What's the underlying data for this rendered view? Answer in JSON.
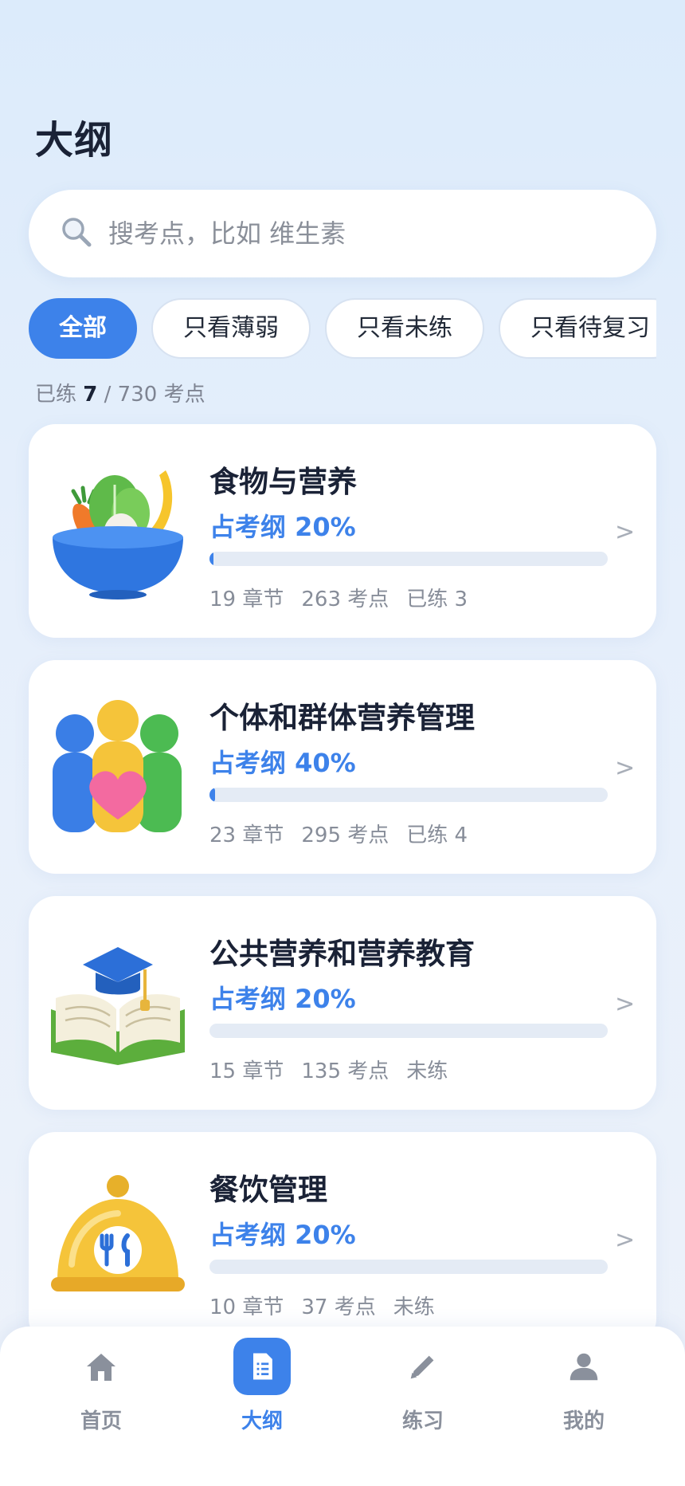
{
  "page": {
    "title": "大纲"
  },
  "search": {
    "placeholder": "搜考点，比如 维生素",
    "icon": "search-icon"
  },
  "filters": [
    {
      "label": "全部",
      "active": true
    },
    {
      "label": "只看薄弱",
      "active": false
    },
    {
      "label": "只看未练",
      "active": false
    },
    {
      "label": "只看待复习",
      "active": false
    }
  ],
  "stats": {
    "prefix": "已练",
    "done": "7",
    "separator": "/",
    "total": "730",
    "suffix": "考点"
  },
  "modules": [
    {
      "title": "食物与营养",
      "weight": "占考纲 20%",
      "progress": 0.011,
      "chapters": "19 章节",
      "points": "263 考点",
      "status": "已练 3",
      "icon": "salad-bowl-icon"
    },
    {
      "title": "个体和群体营养管理",
      "weight": "占考纲 40%",
      "progress": 0.014,
      "chapters": "23 章节",
      "points": "295 考点",
      "status": "已练 4",
      "icon": "family-heart-icon"
    },
    {
      "title": "公共营养和营养教育",
      "weight": "占考纲 20%",
      "progress": 0,
      "chapters": "15 章节",
      "points": "135 考点",
      "status": "未练",
      "icon": "book-graduation-cap-icon"
    },
    {
      "title": "餐饮管理",
      "weight": "占考纲 20%",
      "progress": 0,
      "chapters": "10 章节",
      "points": "37 考点",
      "status": "未练",
      "icon": "dish-cloche-icon"
    }
  ],
  "tabbar": [
    {
      "label": "首页",
      "icon": "home-icon",
      "active": false
    },
    {
      "label": "大纲",
      "icon": "outline-document-icon",
      "active": true
    },
    {
      "label": "练习",
      "icon": "pencil-icon",
      "active": false
    },
    {
      "label": "我的",
      "icon": "user-icon",
      "active": false
    }
  ],
  "colors": {
    "accent": "#3d82ea",
    "background": "#dcebfb",
    "card": "#ffffff",
    "track": "#e4ebf5"
  }
}
